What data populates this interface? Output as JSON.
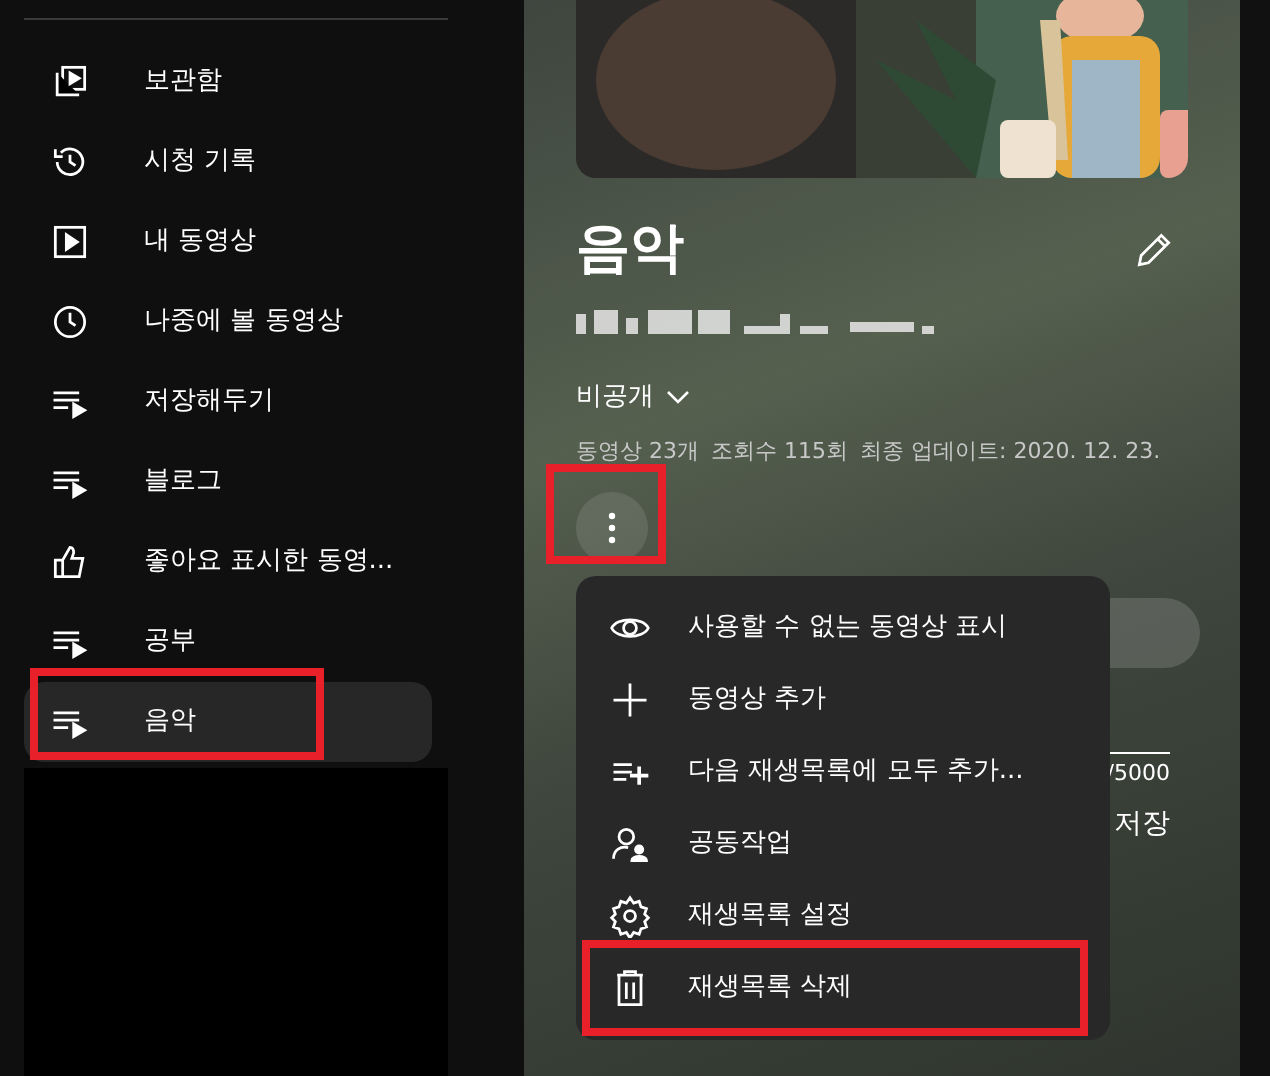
{
  "sidebar": {
    "items": [
      {
        "label": "보관함",
        "selected": false,
        "highlighted": false
      },
      {
        "label": "시청 기록",
        "selected": false,
        "highlighted": false
      },
      {
        "label": "내 동영상",
        "selected": false,
        "highlighted": false
      },
      {
        "label": "나중에 볼 동영상",
        "selected": false,
        "highlighted": false
      },
      {
        "label": "저장해두기",
        "selected": false,
        "highlighted": false
      },
      {
        "label": "블로그",
        "selected": false,
        "highlighted": false
      },
      {
        "label": "좋아요 표시한 동영...",
        "selected": false,
        "highlighted": false
      },
      {
        "label": "공부",
        "selected": false,
        "highlighted": false
      },
      {
        "label": "음악",
        "selected": true,
        "highlighted": true
      }
    ]
  },
  "playlist": {
    "title": "음악",
    "privacy": "비공개",
    "stats": [
      "동영상 23개",
      "조회수 115회",
      "최종 업데이트: 2020. 12. 23."
    ],
    "more_button": {
      "highlighted": true
    },
    "char_count": "/5000",
    "save_label": "저장"
  },
  "menu": {
    "items": [
      {
        "label": "사용할 수 없는 동영상 표시",
        "highlighted": false
      },
      {
        "label": "동영상 추가",
        "highlighted": false
      },
      {
        "label": "다음 재생목록에 모두 추가...",
        "highlighted": false
      },
      {
        "label": "공동작업",
        "highlighted": false
      },
      {
        "label": "재생목록 설정",
        "highlighted": false
      },
      {
        "label": "재생목록 삭제",
        "highlighted": true
      }
    ]
  }
}
